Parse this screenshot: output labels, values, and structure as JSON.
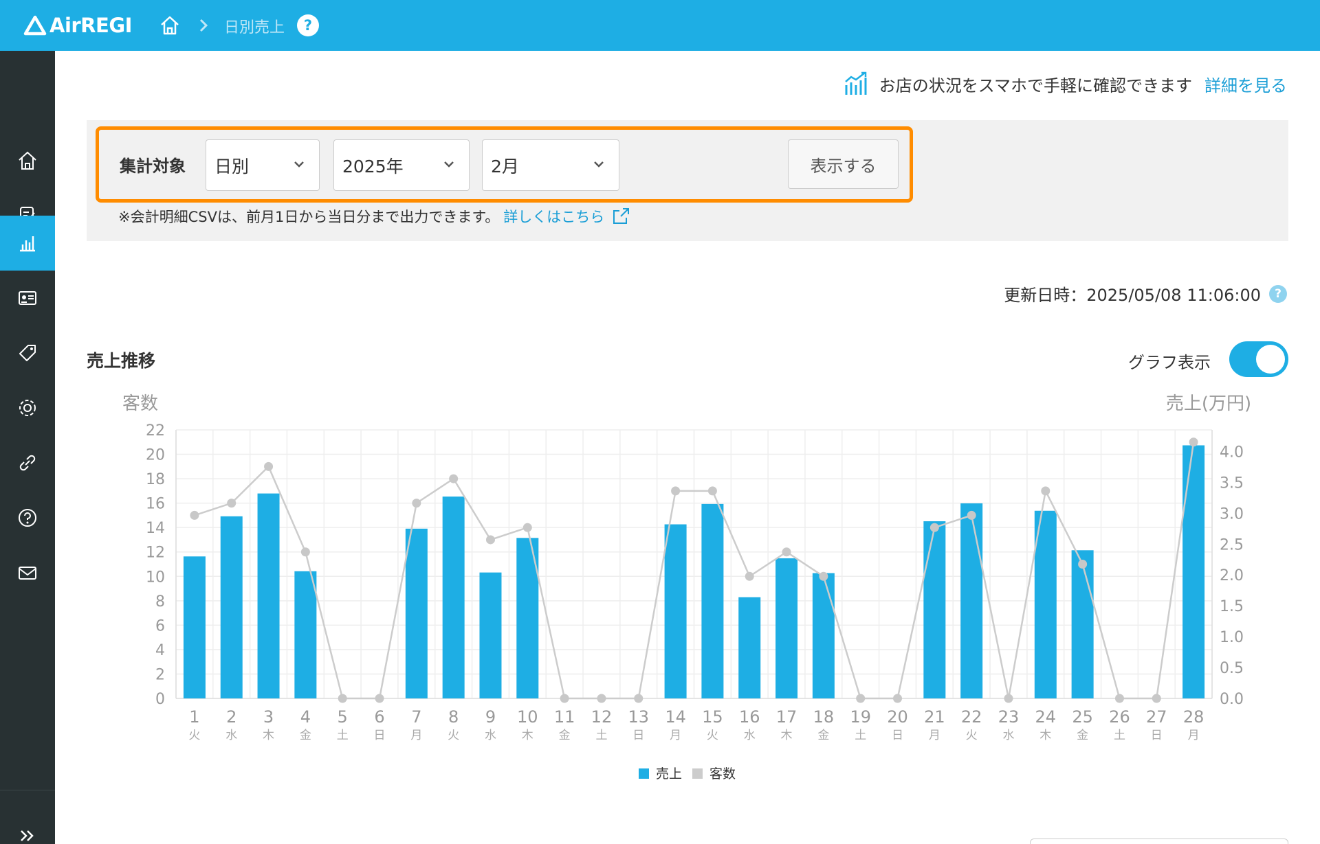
{
  "header": {
    "logo_text": "AirREGI",
    "breadcrumb_current": "日別売上",
    "help_symbol": "?"
  },
  "sidebar": {
    "items": [
      {
        "name": "home-icon"
      },
      {
        "name": "register-icon"
      },
      {
        "name": "chart-icon",
        "active": true
      },
      {
        "name": "id-card-icon"
      },
      {
        "name": "tag-icon"
      },
      {
        "name": "gear-icon"
      },
      {
        "name": "link-icon"
      },
      {
        "name": "help-icon"
      },
      {
        "name": "mail-icon"
      }
    ],
    "expand_label": ">>"
  },
  "promo": {
    "text": "お店の状況をスマホで手軽に確認できます",
    "link": "詳細を見る"
  },
  "filter": {
    "label": "集計対象",
    "period": "日別",
    "year": "2025年",
    "month": "2月",
    "show_button": "表示する",
    "csv_note": "※会計明細CSVは、前月1日から当日分まで出力できます。",
    "csv_link": "詳しくはこちら"
  },
  "updated": {
    "text": "更新日時：2025/05/08 11:06:00",
    "help_symbol": "?"
  },
  "section": {
    "title": "売上推移",
    "graph_toggle_label": "グラフ表示",
    "graph_toggle_on": true
  },
  "colors": {
    "brand": "#1eaee4",
    "bar": "#1eaee4",
    "line": "#cccccc",
    "highlight": "#ff8c00",
    "sidebar": "#283133"
  },
  "chart_data": {
    "type": "bar",
    "left_axis_label": "客数",
    "right_axis_label": "売上(万円)",
    "left_ylim": [
      0,
      22
    ],
    "left_ticks": [
      0,
      2,
      4,
      6,
      8,
      10,
      12,
      14,
      16,
      18,
      20,
      22
    ],
    "right_ylim": [
      0,
      4.35
    ],
    "right_ticks": [
      "0.0",
      "0.5",
      "1.0",
      "1.5",
      "2.0",
      "2.5",
      "3.0",
      "3.5",
      "4.0"
    ],
    "grid": true,
    "legend_position": "bottom",
    "categories": [
      "1",
      "2",
      "3",
      "4",
      "5",
      "6",
      "7",
      "8",
      "9",
      "10",
      "11",
      "12",
      "13",
      "14",
      "15",
      "16",
      "17",
      "18",
      "19",
      "20",
      "21",
      "22",
      "23",
      "24",
      "25",
      "26",
      "27",
      "28"
    ],
    "weekdays": [
      "火",
      "水",
      "木",
      "金",
      "土",
      "日",
      "月",
      "火",
      "水",
      "木",
      "金",
      "土",
      "日",
      "月",
      "火",
      "水",
      "木",
      "金",
      "土",
      "日",
      "月",
      "火",
      "水",
      "木",
      "金",
      "土",
      "日",
      "月"
    ],
    "series": [
      {
        "name": "売上",
        "kind": "bar",
        "axis": "right",
        "values": [
          2.3,
          2.95,
          3.32,
          2.06,
          0,
          0,
          2.75,
          3.27,
          2.04,
          2.6,
          0,
          0,
          0,
          2.82,
          3.15,
          1.64,
          2.27,
          2.03,
          0,
          0,
          2.87,
          3.16,
          0,
          3.04,
          2.4,
          0,
          0,
          4.1
        ]
      },
      {
        "name": "客数",
        "kind": "line",
        "axis": "left",
        "values": [
          15,
          16,
          19,
          12,
          0,
          0,
          16,
          18,
          13,
          14,
          0,
          0,
          0,
          17,
          17,
          10,
          12,
          10,
          0,
          0,
          14,
          15,
          0,
          17,
          11,
          0,
          0,
          21
        ]
      }
    ]
  }
}
